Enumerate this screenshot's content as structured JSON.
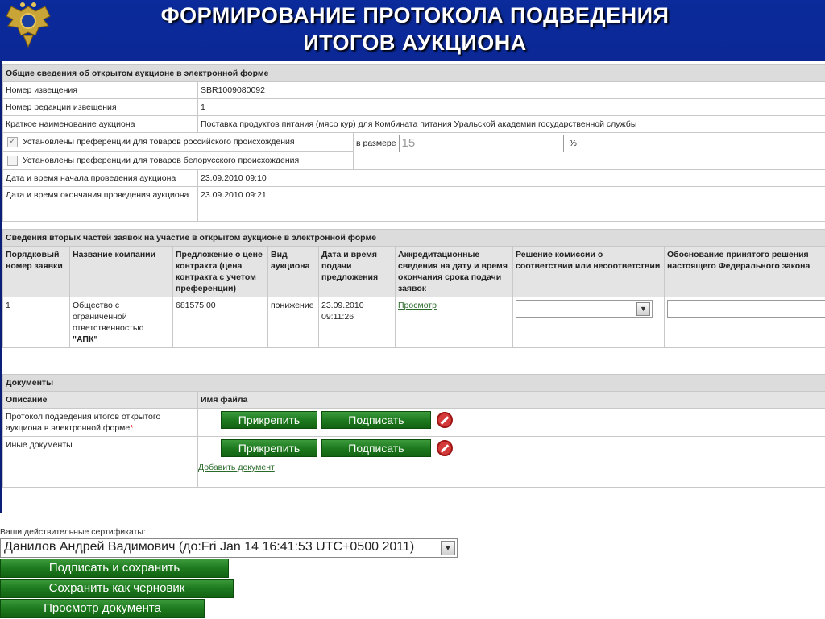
{
  "slide": {
    "title_line1": "ФОРМИРОВАНИЕ ПРОТОКОЛА ПОДВЕДЕНИЯ",
    "title_line2": "ИТОГОВ АУКЦИОНА"
  },
  "general": {
    "heading": "Общие сведения об открытом аукционе в электронной форме",
    "rows": [
      {
        "label": "Номер извещения",
        "value": "SBR1009080092"
      },
      {
        "label": "Номер редакции извещения",
        "value": "1"
      },
      {
        "label": "Краткое наименование аукциона",
        "value": "Поставка продуктов питания (мясо кур) для Комбината питания Уральской академии государственной службы"
      }
    ],
    "pref_russia": "Установлены преференции для товаров российского происхождения",
    "pref_belarus": "Установлены преференции для товаров белорусского происхождения",
    "pref_size_label": "в размере",
    "pref_size_value": "15",
    "pref_unit": "%",
    "start_label": "Дата и время начала проведения аукциона",
    "start_value": "23.09.2010 09:10",
    "end_label": "Дата и время окончания проведения аукциона",
    "end_value": "23.09.2010 09:21"
  },
  "applications": {
    "heading": "Сведения вторых частей заявок на участие в открытом аукционе в электронной форме",
    "columns": [
      "Порядковый номер заявки",
      "Название компании",
      "Предложение о цене контракта (цена контракта с учетом преференции)",
      "Вид аукциона",
      "Дата и время подачи предложения",
      "Аккредитационные сведения на дату и время окончания срока подачи заявок",
      "Решение комиссии о соответствии или несоответствии",
      "Обоснование принятого решения настоящего Федерального закона"
    ],
    "row": {
      "num": "1",
      "company": "Общество с ограниченной ответственностью",
      "company_name": "\"АПК\"",
      "price": "681575.00",
      "type": "понижение",
      "date": "23.09.2010 09:11:26",
      "link": "Просмотр"
    }
  },
  "documents": {
    "heading": "Документы",
    "col_desc": "Описание",
    "col_file": "Имя файла",
    "doc1": "Протокол подведения итогов открытого аукциона в электронной форме",
    "doc1_mark": "*",
    "doc2": "Иные документы",
    "attach": "Прикрепить",
    "sign": "Подписать",
    "add_doc": "Добавить документ"
  },
  "certificates": {
    "label": "Ваши действительные сертификаты:",
    "selected": "Данилов Андрей Вадимович (до:Fri Jan 14 16:41:53 UTC+0500 2011)"
  },
  "actions": {
    "sign_save": "Подписать и сохранить",
    "save_draft": "Сохранить как черновик",
    "preview": "Просмотр документа"
  },
  "colors": {
    "slide_blue": "#0a1f78",
    "button_green": "#1e7a1e",
    "header_gray": "#dcdcdc"
  }
}
